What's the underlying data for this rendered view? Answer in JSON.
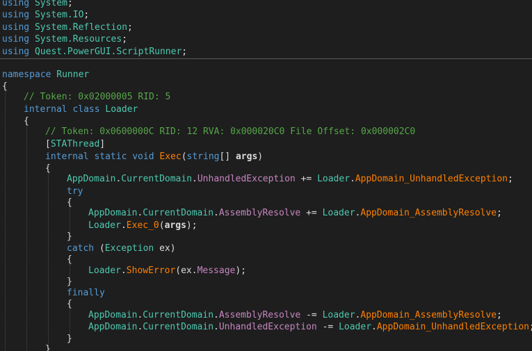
{
  "editor": {
    "usings": [
      {
        "keyword": "using",
        "name": "System",
        "end": ";"
      },
      {
        "keyword": "using",
        "name": "System.IO",
        "end": ";"
      },
      {
        "keyword": "using",
        "name": "System.Reflection",
        "end": ";"
      },
      {
        "keyword": "using",
        "name": "System.Resources",
        "end": ";"
      },
      {
        "keyword": "using",
        "name": "Quest.PowerGUI.ScriptRunner",
        "end": ";"
      }
    ],
    "namespace_kw": "namespace",
    "namespace_name": "Runner",
    "brace_open": "{",
    "brace_close": "}",
    "class_comment": "// Token: 0x02000005 RID: 5",
    "class_kw": "internal class",
    "class_name": "Loader",
    "method_comment": "// Token: 0x0600000C RID: 12 RVA: 0x000020C0 File Offset: 0x000002C0",
    "attr_open": "[",
    "attr_name": "STAThread",
    "attr_close": "]",
    "method_kw": "internal static void",
    "method_name": "Exec",
    "method_params_open": "(",
    "param_type": "string",
    "param_arr": "[] ",
    "param_name": "args",
    "method_params_close": ")",
    "appdomain": "AppDomain",
    "current_domain": "CurrentDomain",
    "unhandled_exception": "UnhandledException",
    "assembly_resolve": "AssemblyResolve",
    "loader": "Loader",
    "handler_unhandled": "AppDomain_UnhandledException",
    "handler_assembly": "AppDomain_AssemblyResolve",
    "op_add": " += ",
    "op_sub": " -= ",
    "dot": ".",
    "semicolon": ";",
    "try_kw": "try",
    "exec0": "Exec_0",
    "args_open": "(",
    "args_name": "args",
    "args_close": ");",
    "catch_kw": "catch",
    "catch_open": " (",
    "exception_type": "Exception",
    "exception_var": " ex)",
    "show_error": "ShowError",
    "ex_open": "(ex.",
    "message_prop": "Message",
    "ex_close": ");",
    "finally_kw": "finally"
  }
}
